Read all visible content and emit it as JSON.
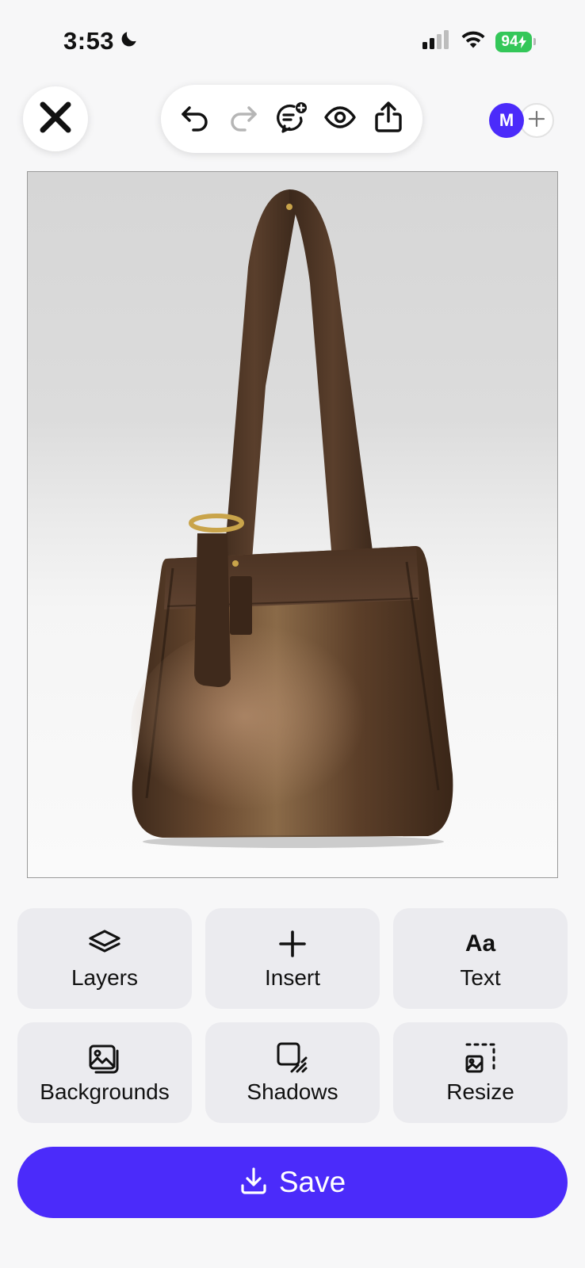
{
  "status_bar": {
    "time": "3:53",
    "battery": "94"
  },
  "toolbar": {
    "close_icon": "close-icon",
    "tools": [
      "undo-icon",
      "redo-icon",
      "add-comment-icon",
      "preview-eye-icon",
      "share-icon"
    ],
    "avatar_initial": "M"
  },
  "canvas": {
    "subject": "brown-leather-shoulder-bag"
  },
  "actions": [
    {
      "label": "Layers",
      "icon": "layers-icon"
    },
    {
      "label": "Insert",
      "icon": "plus-icon"
    },
    {
      "label": "Text",
      "icon": "text-aa-icon",
      "glyph": "Aa"
    },
    {
      "label": "Backgrounds",
      "icon": "backgrounds-icon"
    },
    {
      "label": "Shadows",
      "icon": "shadows-icon"
    },
    {
      "label": "Resize",
      "icon": "resize-icon"
    }
  ],
  "save": {
    "label": "Save",
    "icon": "download-icon"
  },
  "colors": {
    "accent": "#4b2bfa",
    "battery": "#34c759",
    "tile_bg": "#ebebef"
  }
}
